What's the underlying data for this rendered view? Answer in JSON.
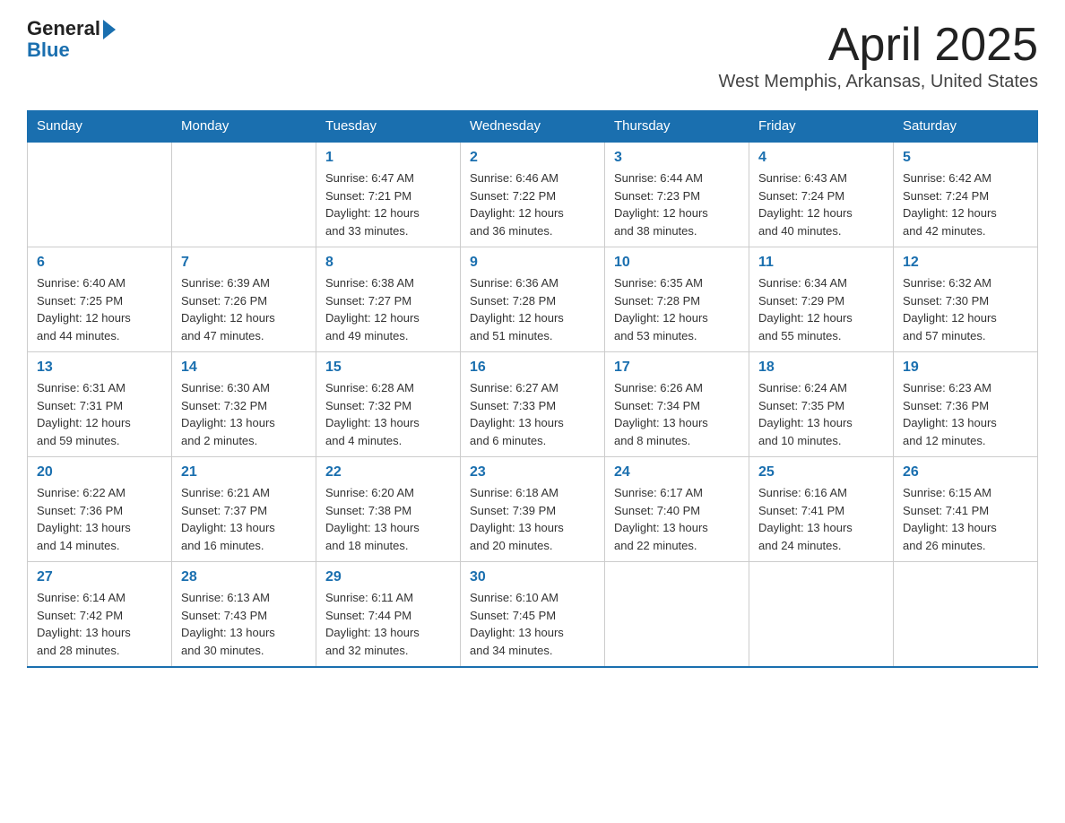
{
  "logo": {
    "text_general": "General",
    "text_blue": "Blue",
    "arrow": "▶"
  },
  "title": "April 2025",
  "location": "West Memphis, Arkansas, United States",
  "days_of_week": [
    "Sunday",
    "Monday",
    "Tuesday",
    "Wednesday",
    "Thursday",
    "Friday",
    "Saturday"
  ],
  "weeks": [
    [
      {
        "day": "",
        "info": ""
      },
      {
        "day": "",
        "info": ""
      },
      {
        "day": "1",
        "info": "Sunrise: 6:47 AM\nSunset: 7:21 PM\nDaylight: 12 hours\nand 33 minutes."
      },
      {
        "day": "2",
        "info": "Sunrise: 6:46 AM\nSunset: 7:22 PM\nDaylight: 12 hours\nand 36 minutes."
      },
      {
        "day": "3",
        "info": "Sunrise: 6:44 AM\nSunset: 7:23 PM\nDaylight: 12 hours\nand 38 minutes."
      },
      {
        "day": "4",
        "info": "Sunrise: 6:43 AM\nSunset: 7:24 PM\nDaylight: 12 hours\nand 40 minutes."
      },
      {
        "day": "5",
        "info": "Sunrise: 6:42 AM\nSunset: 7:24 PM\nDaylight: 12 hours\nand 42 minutes."
      }
    ],
    [
      {
        "day": "6",
        "info": "Sunrise: 6:40 AM\nSunset: 7:25 PM\nDaylight: 12 hours\nand 44 minutes."
      },
      {
        "day": "7",
        "info": "Sunrise: 6:39 AM\nSunset: 7:26 PM\nDaylight: 12 hours\nand 47 minutes."
      },
      {
        "day": "8",
        "info": "Sunrise: 6:38 AM\nSunset: 7:27 PM\nDaylight: 12 hours\nand 49 minutes."
      },
      {
        "day": "9",
        "info": "Sunrise: 6:36 AM\nSunset: 7:28 PM\nDaylight: 12 hours\nand 51 minutes."
      },
      {
        "day": "10",
        "info": "Sunrise: 6:35 AM\nSunset: 7:28 PM\nDaylight: 12 hours\nand 53 minutes."
      },
      {
        "day": "11",
        "info": "Sunrise: 6:34 AM\nSunset: 7:29 PM\nDaylight: 12 hours\nand 55 minutes."
      },
      {
        "day": "12",
        "info": "Sunrise: 6:32 AM\nSunset: 7:30 PM\nDaylight: 12 hours\nand 57 minutes."
      }
    ],
    [
      {
        "day": "13",
        "info": "Sunrise: 6:31 AM\nSunset: 7:31 PM\nDaylight: 12 hours\nand 59 minutes."
      },
      {
        "day": "14",
        "info": "Sunrise: 6:30 AM\nSunset: 7:32 PM\nDaylight: 13 hours\nand 2 minutes."
      },
      {
        "day": "15",
        "info": "Sunrise: 6:28 AM\nSunset: 7:32 PM\nDaylight: 13 hours\nand 4 minutes."
      },
      {
        "day": "16",
        "info": "Sunrise: 6:27 AM\nSunset: 7:33 PM\nDaylight: 13 hours\nand 6 minutes."
      },
      {
        "day": "17",
        "info": "Sunrise: 6:26 AM\nSunset: 7:34 PM\nDaylight: 13 hours\nand 8 minutes."
      },
      {
        "day": "18",
        "info": "Sunrise: 6:24 AM\nSunset: 7:35 PM\nDaylight: 13 hours\nand 10 minutes."
      },
      {
        "day": "19",
        "info": "Sunrise: 6:23 AM\nSunset: 7:36 PM\nDaylight: 13 hours\nand 12 minutes."
      }
    ],
    [
      {
        "day": "20",
        "info": "Sunrise: 6:22 AM\nSunset: 7:36 PM\nDaylight: 13 hours\nand 14 minutes."
      },
      {
        "day": "21",
        "info": "Sunrise: 6:21 AM\nSunset: 7:37 PM\nDaylight: 13 hours\nand 16 minutes."
      },
      {
        "day": "22",
        "info": "Sunrise: 6:20 AM\nSunset: 7:38 PM\nDaylight: 13 hours\nand 18 minutes."
      },
      {
        "day": "23",
        "info": "Sunrise: 6:18 AM\nSunset: 7:39 PM\nDaylight: 13 hours\nand 20 minutes."
      },
      {
        "day": "24",
        "info": "Sunrise: 6:17 AM\nSunset: 7:40 PM\nDaylight: 13 hours\nand 22 minutes."
      },
      {
        "day": "25",
        "info": "Sunrise: 6:16 AM\nSunset: 7:41 PM\nDaylight: 13 hours\nand 24 minutes."
      },
      {
        "day": "26",
        "info": "Sunrise: 6:15 AM\nSunset: 7:41 PM\nDaylight: 13 hours\nand 26 minutes."
      }
    ],
    [
      {
        "day": "27",
        "info": "Sunrise: 6:14 AM\nSunset: 7:42 PM\nDaylight: 13 hours\nand 28 minutes."
      },
      {
        "day": "28",
        "info": "Sunrise: 6:13 AM\nSunset: 7:43 PM\nDaylight: 13 hours\nand 30 minutes."
      },
      {
        "day": "29",
        "info": "Sunrise: 6:11 AM\nSunset: 7:44 PM\nDaylight: 13 hours\nand 32 minutes."
      },
      {
        "day": "30",
        "info": "Sunrise: 6:10 AM\nSunset: 7:45 PM\nDaylight: 13 hours\nand 34 minutes."
      },
      {
        "day": "",
        "info": ""
      },
      {
        "day": "",
        "info": ""
      },
      {
        "day": "",
        "info": ""
      }
    ]
  ]
}
